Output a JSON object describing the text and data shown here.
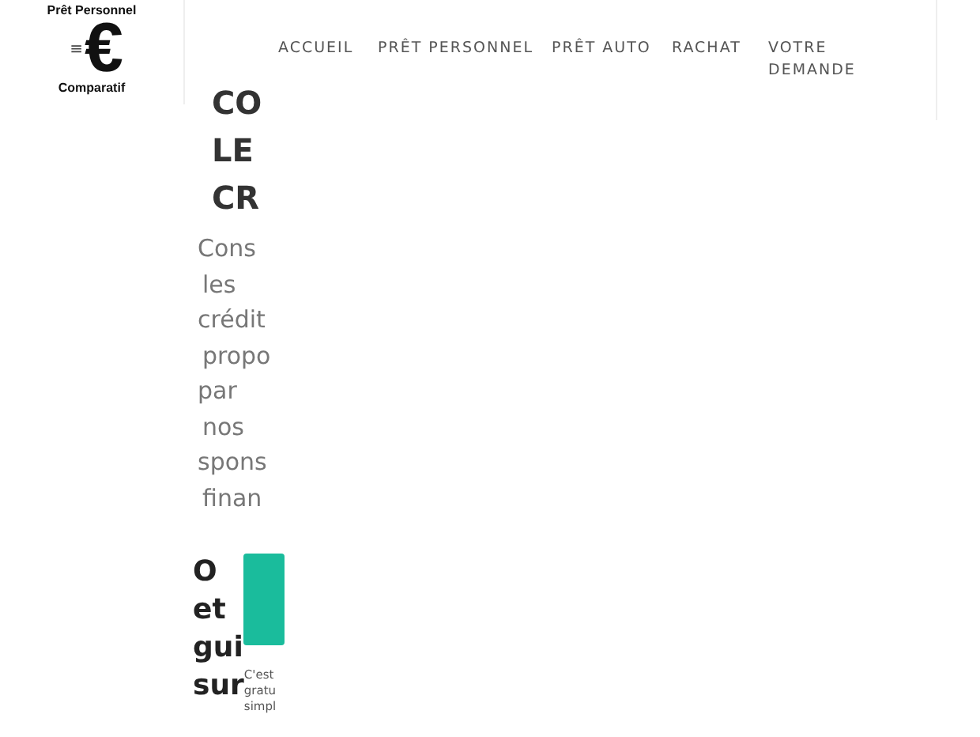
{
  "logo": {
    "top": "Prêt Personnel",
    "symbol": "€",
    "bottom": "Comparatif"
  },
  "menu_icon": "≡",
  "nav": [
    {
      "label": "ACCUEIL"
    },
    {
      "label": "PRÊT PERSONNEL"
    },
    {
      "label": "PRÊT AUTO"
    },
    {
      "label": "RACHAT"
    },
    {
      "label": "VOTRE DEMANDE"
    }
  ],
  "heading": [
    "CO",
    "LE",
    "CR"
  ],
  "intro": [
    "Cons",
    "les",
    "crédit",
    "propo",
    "par",
    "nos",
    "spons",
    "finan"
  ],
  "heading_2": [
    "O",
    "et",
    "gui",
    "sur"
  ],
  "note": [
    "C'est",
    "gratu",
    "simpl"
  ]
}
